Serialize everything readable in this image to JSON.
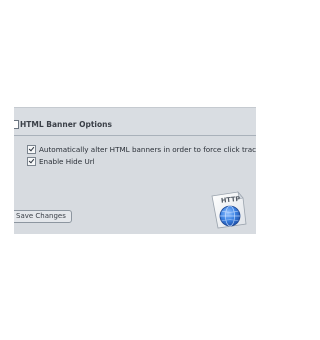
{
  "section": {
    "title": "HTML Banner Options"
  },
  "options": [
    {
      "label": "Automatically alter HTML banners in order to force click tracking",
      "checked": true
    },
    {
      "label": "Enable Hide Url",
      "checked": true
    }
  ],
  "buttons": {
    "save_label": "Save Changes"
  },
  "icon": {
    "name": "http-document-icon",
    "text": "HTTP"
  },
  "colors": {
    "panel_bg": "#d7dbe0",
    "divider": "#a9b1ba",
    "globe_blue": "#2e6fd0"
  }
}
